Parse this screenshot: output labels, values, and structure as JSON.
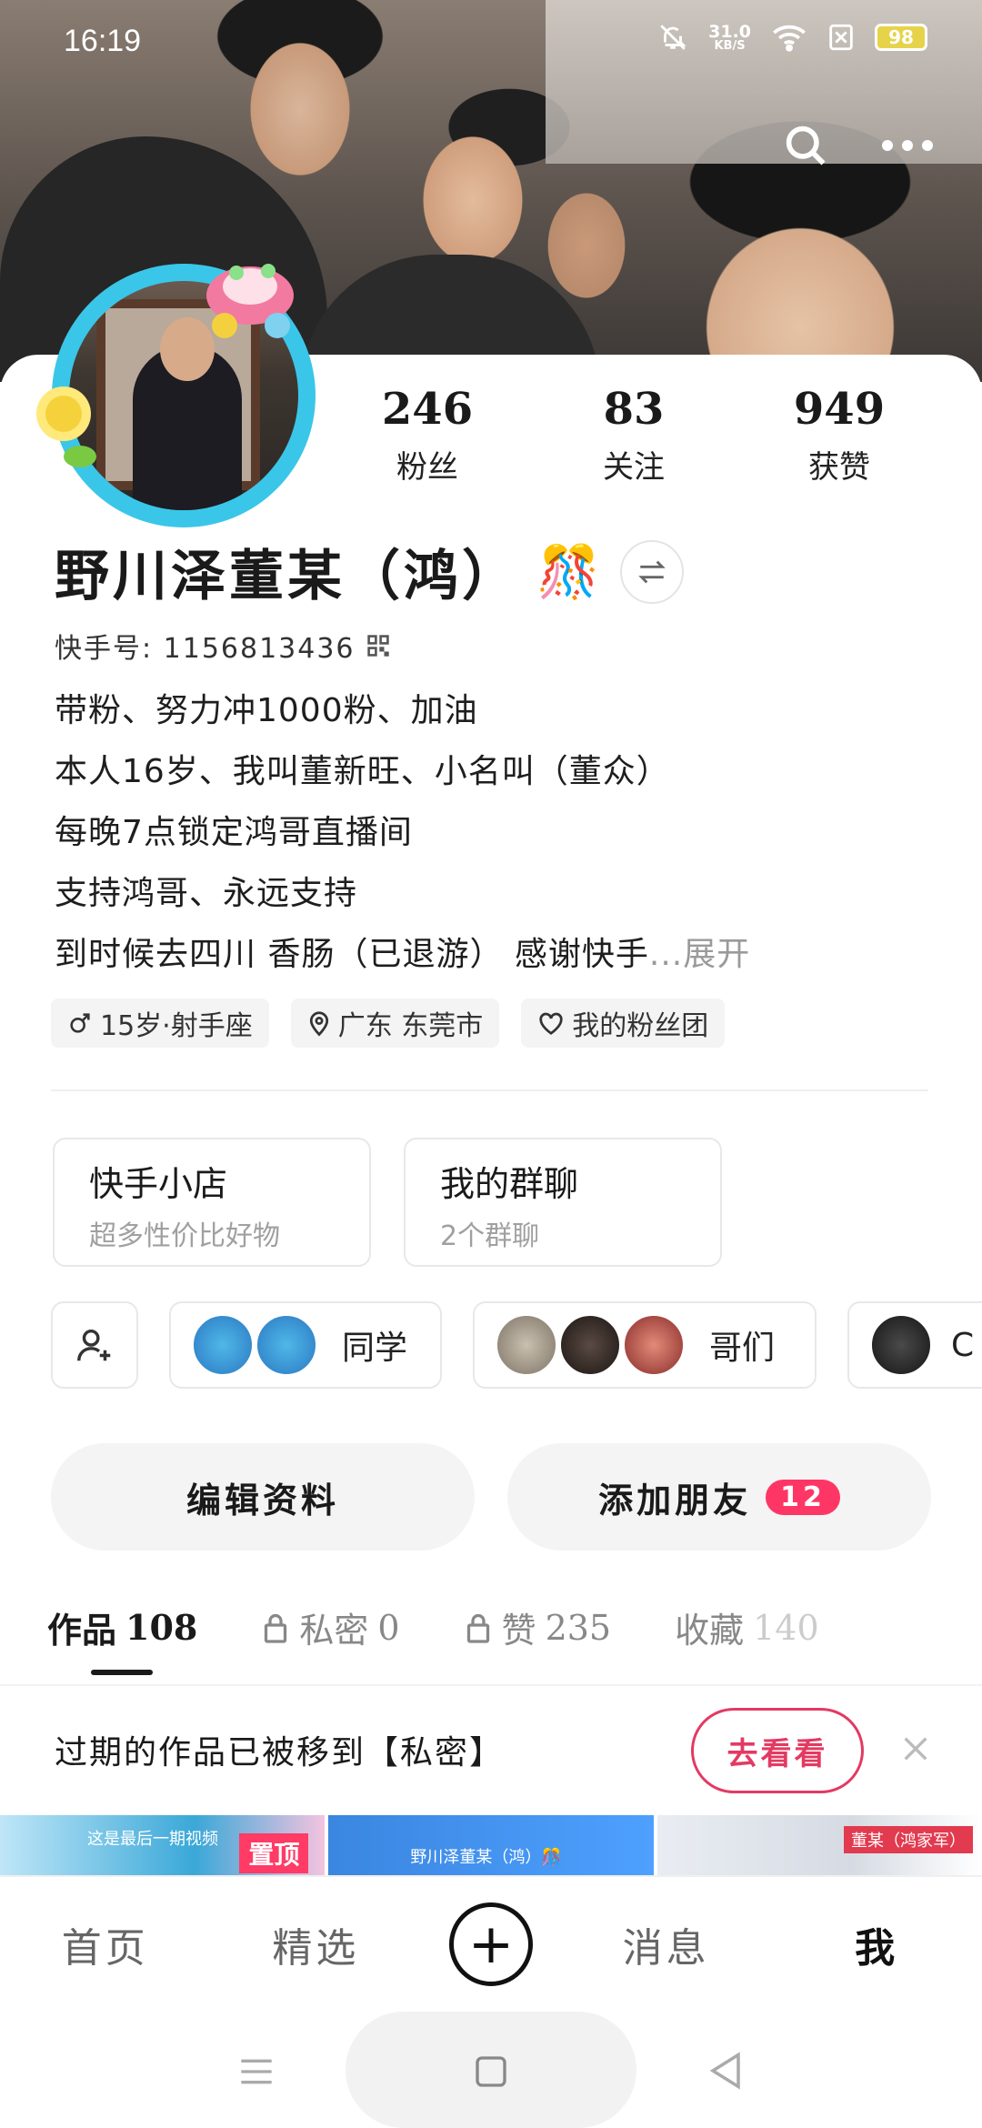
{
  "status_bar": {
    "time": "16:19",
    "net_speed": "31.0",
    "net_unit": "KB/S",
    "battery": "98",
    "icons": [
      "bell-off-icon",
      "wifi-icon",
      "sim-off-icon",
      "battery-icon"
    ]
  },
  "header": {
    "icons": [
      "search-icon",
      "more-icon"
    ]
  },
  "profile": {
    "name": "野川泽董某（鸿）",
    "name_emoji": "🎊",
    "kuaishou_id_label": "快手号: 1156813436",
    "stats": [
      {
        "value": "246",
        "label": "粉丝"
      },
      {
        "value": "83",
        "label": "关注"
      },
      {
        "value": "949",
        "label": "获赞"
      }
    ],
    "bio_lines": [
      "带粉、努力冲1000粉、加油",
      "本人16岁、我叫董新旺、小名叫（董众）",
      "每晚7点锁定鸿哥直播间",
      "支持鸿哥、永远支持",
      "到时候去四川 香肠（已退游） 感谢快手"
    ],
    "bio_more": "...展开",
    "tags": [
      {
        "icon": "male-icon",
        "text": "15岁·射手座"
      },
      {
        "icon": "location-icon",
        "text": "广东 东莞市"
      },
      {
        "icon": "heart-icon",
        "text": "我的粉丝团"
      }
    ]
  },
  "features": [
    {
      "title": "快手小店",
      "subtitle": "超多性价比好物"
    },
    {
      "title": "我的群聊",
      "subtitle": "2个群聊"
    }
  ],
  "groups": [
    {
      "label": "同学"
    },
    {
      "label": "哥们"
    },
    {
      "label": "C"
    }
  ],
  "actions": {
    "edit": "编辑资料",
    "add_friend": "添加朋友",
    "add_friend_badge": "12"
  },
  "tabs": [
    {
      "label": "作品",
      "count": "108"
    },
    {
      "label": "私密",
      "count": "0"
    },
    {
      "label": "赞",
      "count": "235"
    },
    {
      "label": "收藏",
      "count": "140"
    }
  ],
  "notice": {
    "text": "过期的作品已被移到【私密】",
    "button": "去看看"
  },
  "thumbs": [
    {
      "caption": "这是最后一期视频",
      "pin": "置顶"
    },
    {
      "caption": "野川泽董某（鸿）🎊"
    },
    {
      "caption": "董某（鸿家军）"
    }
  ],
  "bottom_nav": {
    "home": "首页",
    "featured": "精选",
    "messages": "消息",
    "me": "我"
  }
}
